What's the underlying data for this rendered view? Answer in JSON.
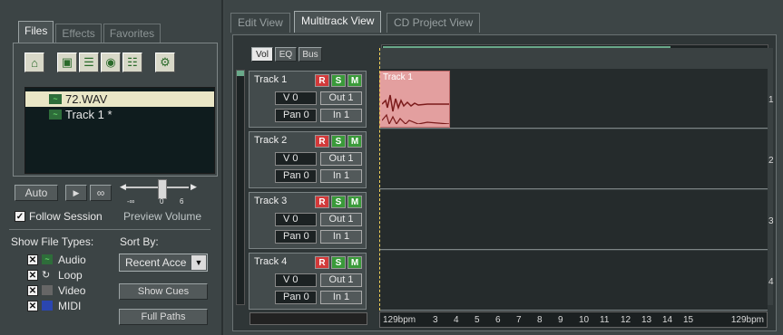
{
  "organizer": {
    "tabs": [
      "Files",
      "Effects",
      "Favorites"
    ],
    "active_tab": "Files",
    "files": [
      {
        "name": "72.WAV",
        "selected": true
      },
      {
        "name": "Track 1 *",
        "selected": false
      }
    ],
    "auto_label": "Auto",
    "play_glyph": "▶",
    "loop_glyph": "∞",
    "follow_session_label": "Follow Session",
    "preview_volume_label": "Preview Volume",
    "volume_scale": [
      "-∞",
      "0",
      "6"
    ],
    "show_file_types_label": "Show File Types:",
    "file_types": [
      {
        "label": "Audio",
        "checked": true
      },
      {
        "label": "Loop",
        "checked": true
      },
      {
        "label": "Video",
        "checked": true
      },
      {
        "label": "MIDI",
        "checked": true
      }
    ],
    "sort_by_label": "Sort By:",
    "sort_value": "Recent Acce",
    "show_cues_label": "Show Cues",
    "full_paths_label": "Full Paths"
  },
  "view_tabs": [
    "Edit View",
    "Multitrack View",
    "CD Project View"
  ],
  "active_view": "Multitrack View",
  "track_tabs": [
    "Vol",
    "EQ",
    "Bus"
  ],
  "tracks": [
    {
      "name": "Track 1",
      "r": "R",
      "s": "S",
      "m": "M",
      "volume": "V 0",
      "pan": "Pan 0",
      "out": "Out 1",
      "in": "In 1",
      "lane": "1"
    },
    {
      "name": "Track 2",
      "r": "R",
      "s": "S",
      "m": "M",
      "volume": "V 0",
      "pan": "Pan 0",
      "out": "Out 1",
      "in": "In 1",
      "lane": "2"
    },
    {
      "name": "Track 3",
      "r": "R",
      "s": "S",
      "m": "M",
      "volume": "V 0",
      "pan": "Pan 0",
      "out": "Out 1",
      "in": "In 1",
      "lane": "3"
    },
    {
      "name": "Track 4",
      "r": "R",
      "s": "S",
      "m": "M",
      "volume": "V 0",
      "pan": "Pan 0",
      "out": "Out 1",
      "in": "In 1",
      "lane": "4"
    }
  ],
  "clip": {
    "name": "Track 1"
  },
  "ruler": {
    "start": "129bpm",
    "end": "129bpm",
    "ticks": [
      "3",
      "4",
      "5",
      "6",
      "7",
      "8",
      "9",
      "10",
      "11",
      "12",
      "13",
      "14",
      "15"
    ]
  },
  "overview_fill": 0.75,
  "colors": {
    "accent_red": "#d23a3a",
    "accent_green": "#3a9a3a",
    "clip": "#e39f9f"
  }
}
